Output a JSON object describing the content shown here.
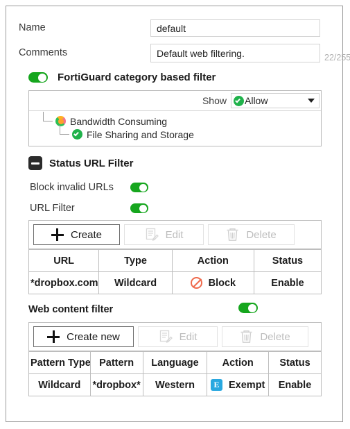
{
  "form": {
    "name_label": "Name",
    "name_value": "default",
    "comments_label": "Comments",
    "comments_value": "Default web filtering.",
    "comments_counter": "22/255"
  },
  "fortiguard": {
    "section_label": "FortiGuard category based filter",
    "toggle_state": "on",
    "show_label": "Show",
    "show_value": "Allow",
    "tree": [
      {
        "label": "Bandwidth Consuming",
        "state": "partial",
        "level": 1
      },
      {
        "label": "File Sharing and Storage",
        "state": "allow",
        "level": 2
      }
    ]
  },
  "status_url_filter": {
    "section_label": "Status URL Filter",
    "collapse_icon": "minus-icon",
    "block_invalid_label": "Block invalid URLs",
    "block_invalid_state": "on",
    "url_filter_label": "URL Filter",
    "url_filter_state": "on",
    "toolbar": {
      "create_label": "Create",
      "edit_label": "Edit",
      "delete_label": "Delete"
    },
    "table": {
      "columns": [
        "URL",
        "Type",
        "Action",
        "Status"
      ],
      "rows": [
        {
          "url": "*dropbox.com",
          "type": "Wildcard",
          "action": "Block",
          "action_icon": "block-icon",
          "status": "Enable"
        }
      ]
    }
  },
  "web_content_filter": {
    "section_label": "Web content filter",
    "toggle_state": "on",
    "toolbar": {
      "create_label": "Create new",
      "edit_label": "Edit",
      "delete_label": "Delete"
    },
    "table": {
      "columns": [
        "Pattern Type",
        "Pattern",
        "Language",
        "Action",
        "Status"
      ],
      "rows": [
        {
          "pattern_type": "Wildcard",
          "pattern": "*dropbox*",
          "language": "Western",
          "action": "Exempt",
          "action_icon": "exempt-icon",
          "status": "Enable"
        }
      ]
    }
  },
  "colors": {
    "toggle_on": "#16a61e",
    "allow_green": "#20b24b",
    "block_orange": "#ef6a4c",
    "exempt_blue": "#29a8e0",
    "border": "#bdbdbd"
  }
}
